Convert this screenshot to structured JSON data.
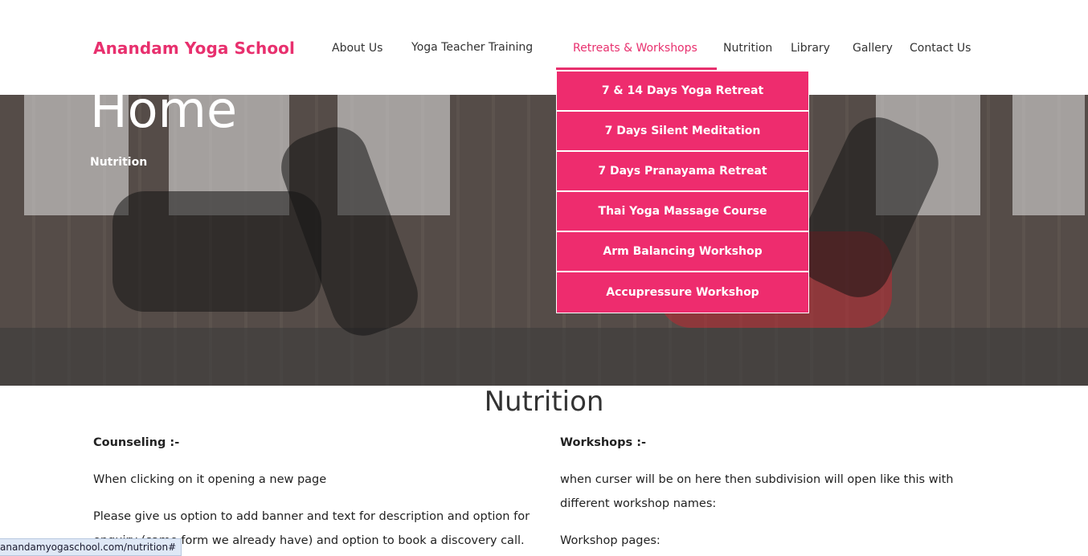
{
  "site": {
    "logo": "Anandam Yoga School"
  },
  "nav": {
    "items": [
      {
        "label": "About Us"
      },
      {
        "label": "Yoga Teacher Training"
      },
      {
        "label": "Retreats & Workshops"
      },
      {
        "label": "Nutrition"
      },
      {
        "label": "Library"
      },
      {
        "label": "Gallery"
      },
      {
        "label": "Contact Us"
      }
    ],
    "active_index": 2
  },
  "dropdown": {
    "items": [
      {
        "label": "7 & 14 Days Yoga Retreat"
      },
      {
        "label": "7 Days Silent Meditation"
      },
      {
        "label": "7 Days Pranayama Retreat"
      },
      {
        "label": "Thai Yoga Massage Course"
      },
      {
        "label": "Arm Balancing Workshop"
      },
      {
        "label": "Accupressure Workshop"
      }
    ],
    "background_color": "#ee2c6e"
  },
  "hero": {
    "title": "Home",
    "breadcrumb": "Nutrition"
  },
  "content": {
    "title": "Nutrition",
    "left": {
      "heading": "Counseling :-",
      "paragraph1": "When clicking on it opening a new page",
      "paragraph2": "Please give us option to add banner and text for description  and option for enquiry (same form we already have)  and option to book a discovery call."
    },
    "right": {
      "heading": "Workshops :-",
      "paragraph1": "when curser will be on here then subdivision will open like this with different workshop names:",
      "paragraph2": "Workshop pages:"
    }
  },
  "status_bar": {
    "url": "anandamyogaschool.com/nutrition#"
  },
  "colors": {
    "accent": "#e8306e"
  }
}
